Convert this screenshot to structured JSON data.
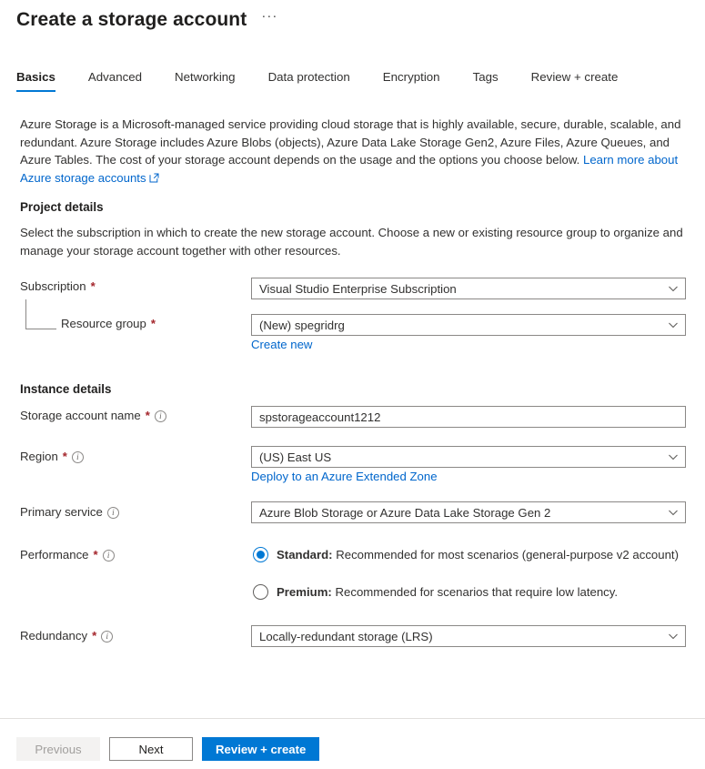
{
  "header": {
    "title": "Create a storage account",
    "more_menu": "···"
  },
  "tabs": [
    {
      "label": "Basics",
      "active": true
    },
    {
      "label": "Advanced",
      "active": false
    },
    {
      "label": "Networking",
      "active": false
    },
    {
      "label": "Data protection",
      "active": false
    },
    {
      "label": "Encryption",
      "active": false
    },
    {
      "label": "Tags",
      "active": false
    },
    {
      "label": "Review + create",
      "active": false
    }
  ],
  "intro": {
    "text": "Azure Storage is a Microsoft-managed service providing cloud storage that is highly available, secure, durable, scalable, and redundant. Azure Storage includes Azure Blobs (objects), Azure Data Lake Storage Gen2, Azure Files, Azure Queues, and Azure Tables. The cost of your storage account depends on the usage and the options you choose below. ",
    "link_label": "Learn more about Azure storage accounts",
    "link_icon": "external-link-icon"
  },
  "project_details": {
    "heading": "Project details",
    "description": "Select the subscription in which to create the new storage account. Choose a new or existing resource group to organize and manage your storage account together with other resources.",
    "subscription": {
      "label": "Subscription",
      "required": "*",
      "value": "Visual Studio Enterprise Subscription"
    },
    "resource_group": {
      "label": "Resource group",
      "required": "*",
      "value": "(New) spegridrg",
      "create_new_label": "Create new"
    }
  },
  "instance_details": {
    "heading": "Instance details",
    "storage_account_name": {
      "label": "Storage account name",
      "required": "*",
      "value": "spstorageaccount1212",
      "info": "i"
    },
    "region": {
      "label": "Region",
      "required": "*",
      "value": "(US) East US",
      "info": "i",
      "sublink_label": "Deploy to an Azure Extended Zone"
    },
    "primary_service": {
      "label": "Primary service",
      "required": "",
      "value": "Azure Blob Storage or Azure Data Lake Storage Gen 2",
      "info": "i"
    },
    "performance": {
      "label": "Performance",
      "required": "*",
      "info": "i",
      "options": [
        {
          "name": "Standard:",
          "desc": " Recommended for most scenarios (general-purpose v2 account)",
          "selected": true
        },
        {
          "name": "Premium:",
          "desc": " Recommended for scenarios that require low latency.",
          "selected": false
        }
      ]
    },
    "redundancy": {
      "label": "Redundancy",
      "required": "*",
      "value": "Locally-redundant storage (LRS)",
      "info": "i"
    }
  },
  "footer": {
    "previous_label": "Previous",
    "next_label": "Next",
    "review_label": "Review + create"
  },
  "colors": {
    "accent": "#0078d4",
    "link": "#0066cc",
    "required": "#a4262c",
    "border": "#8a8886"
  }
}
